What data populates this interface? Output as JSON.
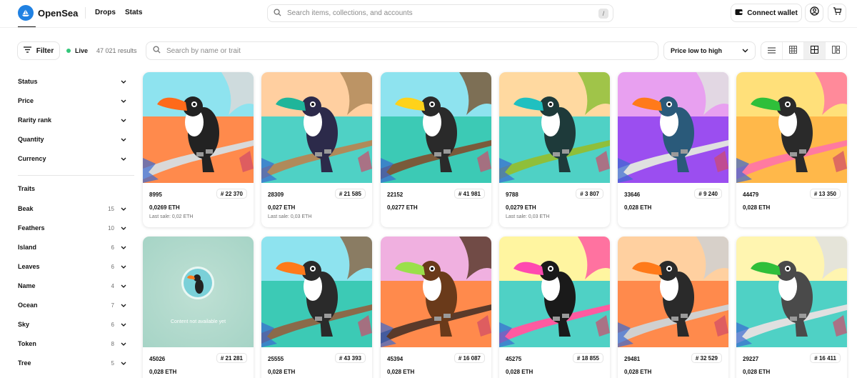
{
  "nav": {
    "brand": "OpenSea",
    "links": [
      "Drops",
      "Stats"
    ],
    "search_placeholder": "Search items, collections, and accounts",
    "search_shortcut": "/",
    "connect_wallet": "Connect wallet"
  },
  "toolbar": {
    "filter_label": "Filter",
    "live_label": "Live",
    "results": "47 021 results",
    "search_placeholder": "Search by name or trait",
    "sort_selected": "Price low to high",
    "view_modes": [
      "list-view-icon",
      "grid-small-icon",
      "grid-large-icon",
      "grid-detail-icon"
    ]
  },
  "sidebar": {
    "filters": [
      "Status",
      "Price",
      "Rarity rank",
      "Quantity",
      "Currency"
    ],
    "traits_heading": "Traits",
    "traits": [
      {
        "name": "Beak",
        "count": "15"
      },
      {
        "name": "Feathers",
        "count": "10"
      },
      {
        "name": "Island",
        "count": "6"
      },
      {
        "name": "Leaves",
        "count": "6"
      },
      {
        "name": "Name",
        "count": "4"
      },
      {
        "name": "Ocean",
        "count": "7"
      },
      {
        "name": "Sky",
        "count": "6"
      },
      {
        "name": "Token",
        "count": "8"
      },
      {
        "name": "Tree",
        "count": "5"
      }
    ]
  },
  "cards": [
    {
      "id": "8995",
      "rank": "# 22 370",
      "price": "0,0269 ETH",
      "last_sale": "Last sale: 0,02 ETH",
      "sky": "#8ee3ef",
      "sea": "#ff8a4c",
      "body": "#222222",
      "beak": "#ff6a1a",
      "branch": "#d9d9d9"
    },
    {
      "id": "28309",
      "rank": "# 21 585",
      "price": "0,027 ETH",
      "last_sale": "Last sale: 0,03 ETH",
      "sky": "#ffcfa0",
      "sea": "#4fd1c5",
      "body": "#2c2a4a",
      "beak": "#1fb59a",
      "branch": "#b08a5a"
    },
    {
      "id": "22152",
      "rank": "# 41 981",
      "price": "0,0277 ETH",
      "last_sale": "",
      "sky": "#8ee3ef",
      "sea": "#3ccab5",
      "body": "#2a2a2a",
      "beak": "#ffd21a",
      "branch": "#7a5a3a"
    },
    {
      "id": "9788",
      "rank": "# 3 807",
      "price": "0,0279 ETH",
      "last_sale": "Last sale: 0,03 ETH",
      "sky": "#ffd9a0",
      "sea": "#4fd1c5",
      "body": "#1e3a3a",
      "beak": "#20c0c0",
      "branch": "#8fbf3a"
    },
    {
      "id": "33646",
      "rank": "# 9 240",
      "price": "0,028 ETH",
      "last_sale": "",
      "sky": "#e8a0f0",
      "sea": "#9b4ef0",
      "body": "#2a5a7a",
      "beak": "#ff7a1a",
      "branch": "#e0e0e0"
    },
    {
      "id": "44479",
      "rank": "# 13 350",
      "price": "0,028 ETH",
      "last_sale": "",
      "sky": "#ffe07a",
      "sea": "#ffb84a",
      "body": "#2a2a2a",
      "beak": "#2fbf3a",
      "branch": "#ff7aa0"
    },
    {
      "id": "45026",
      "rank": "# 21 281",
      "price": "0,028 ETH",
      "last_sale": "",
      "unavailable": "Content not available yet"
    },
    {
      "id": "25555",
      "rank": "# 43 393",
      "price": "0,028 ETH",
      "last_sale": "",
      "sky": "#8ee3ef",
      "sea": "#3ccab5",
      "body": "#2a2a2a",
      "beak": "#ff7a1a",
      "branch": "#8a6a4a"
    },
    {
      "id": "45394",
      "rank": "# 16 087",
      "price": "0,028 ETH",
      "last_sale": "",
      "sky": "#f0b0e0",
      "sea": "#ff8a4c",
      "body": "#6a3a1a",
      "beak": "#9ae04a",
      "branch": "#5a3a2a"
    },
    {
      "id": "45275",
      "rank": "# 18 855",
      "price": "0,028 ETH",
      "last_sale": "",
      "sky": "#fff5a0",
      "sea": "#4fd1c5",
      "body": "#1a1a1a",
      "beak": "#ff4ab0",
      "branch": "#ff5aa0"
    },
    {
      "id": "29481",
      "rank": "# 32 529",
      "price": "0,028 ETH",
      "last_sale": "",
      "sky": "#ffd0a0",
      "sea": "#ff8a4c",
      "body": "#2a2a2a",
      "beak": "#ff7a1a",
      "branch": "#d0d0d0"
    },
    {
      "id": "29227",
      "rank": "# 16 411",
      "price": "0,028 ETH",
      "last_sale": "",
      "sky": "#fff5b0",
      "sea": "#4fd1c5",
      "body": "#4a4a4a",
      "beak": "#2fbf3a",
      "branch": "#e0e0e0"
    }
  ]
}
